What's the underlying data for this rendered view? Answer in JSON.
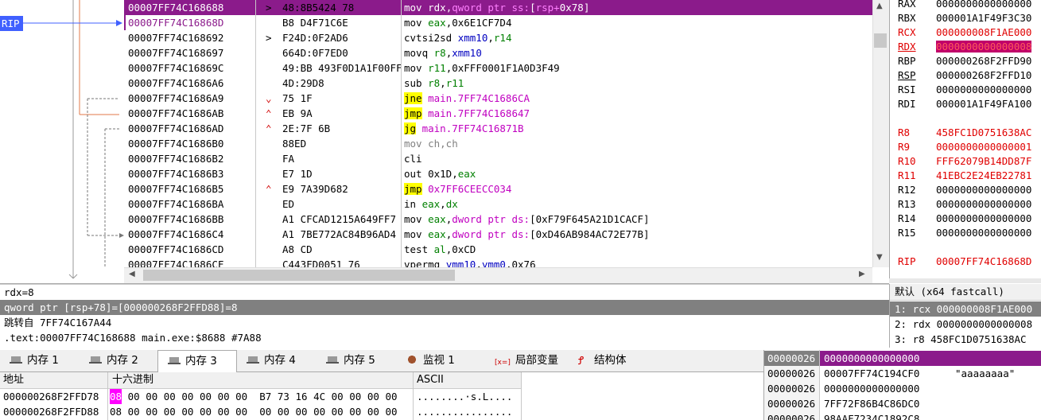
{
  "disasm": {
    "rip_label": "RIP",
    "rows": [
      {
        "addr": "00007FF74C168688",
        "jm": ">",
        "bytes": "48:8B5424 78",
        "insn": [
          [
            "mov ",
            "c"
          ],
          [
            "rdx",
            "r"
          ],
          [
            ",",
            ""
          ],
          [
            "qword ptr ss:",
            "m"
          ],
          [
            "[",
            "c"
          ],
          [
            "rsp+",
            "m"
          ],
          [
            "0x78",
            "c"
          ],
          [
            "]",
            "c"
          ]
        ]
      },
      {
        "addr": "00007FF74C16868D",
        "jm": "",
        "bytes": "B8 D4F71C6E",
        "insn": [
          [
            "mov ",
            ""
          ],
          [
            "eax",
            "g"
          ],
          [
            ",0x6E1CF7D4",
            ""
          ]
        ]
      },
      {
        "addr": "00007FF74C168692",
        "jm": ">",
        "bytes": "F24D:0F2AD6",
        "insn": [
          [
            "cvtsi2sd ",
            ""
          ],
          [
            "xmm10",
            "b"
          ],
          [
            ",",
            ""
          ],
          [
            "r14",
            "g"
          ]
        ]
      },
      {
        "addr": "00007FF74C168697",
        "jm": "",
        "bytes": "664D:0F7ED0",
        "insn": [
          [
            "movq ",
            ""
          ],
          [
            "r8",
            "g"
          ],
          [
            ",",
            ""
          ],
          [
            "xmm10",
            "b"
          ]
        ]
      },
      {
        "addr": "00007FF74C16869C",
        "jm": "",
        "bytes": "49:BB 493F0D1A1F00FF",
        "insn": [
          [
            "mov ",
            ""
          ],
          [
            "r11",
            "g"
          ],
          [
            ",0xFFF0001F1A0D3F49",
            ""
          ]
        ]
      },
      {
        "addr": "00007FF74C1686A6",
        "jm": "",
        "bytes": "4D:29D8",
        "insn": [
          [
            "sub ",
            ""
          ],
          [
            "r8",
            "g"
          ],
          [
            ",",
            ""
          ],
          [
            "r11",
            "g"
          ]
        ]
      },
      {
        "addr": "00007FF74C1686A9",
        "jm": "v",
        "bytes": "75 1F",
        "insn": [
          [
            "jne",
            "j"
          ],
          [
            " main.7FF74C1686CA",
            "l"
          ]
        ]
      },
      {
        "addr": "00007FF74C1686AB",
        "jm": "^",
        "bytes": "EB 9A",
        "insn": [
          [
            "jmp",
            "j"
          ],
          [
            " main.7FF74C168647",
            "l"
          ]
        ]
      },
      {
        "addr": "00007FF74C1686AD",
        "jm": "^",
        "bytes": "2E:7F 6B",
        "insn": [
          [
            "jg",
            "j"
          ],
          [
            " main.7FF74C16871B",
            "l"
          ]
        ]
      },
      {
        "addr": "00007FF74C1686B0",
        "jm": "",
        "bytes": "88ED",
        "insn": [
          [
            "mov ch,ch",
            "y"
          ]
        ]
      },
      {
        "addr": "00007FF74C1686B2",
        "jm": "",
        "bytes": "FA",
        "insn": [
          [
            "cli",
            ""
          ]
        ]
      },
      {
        "addr": "00007FF74C1686B3",
        "jm": "",
        "bytes": "E7 1D",
        "insn": [
          [
            "out 0x1D,",
            ""
          ],
          [
            "eax",
            "g"
          ]
        ]
      },
      {
        "addr": "00007FF74C1686B5",
        "jm": "^",
        "bytes": "E9 7A39D682",
        "insn": [
          [
            "jmp",
            "j"
          ],
          [
            " 0x7FF6CEECC034",
            "l"
          ]
        ]
      },
      {
        "addr": "00007FF74C1686BA",
        "jm": "",
        "bytes": "ED",
        "insn": [
          [
            "in ",
            ""
          ],
          [
            "eax",
            "g"
          ],
          [
            ",",
            ""
          ],
          [
            "dx",
            "g"
          ]
        ]
      },
      {
        "addr": "00007FF74C1686BB",
        "jm": "",
        "bytes": "A1 CFCAD1215A649FF7",
        "insn": [
          [
            "mov ",
            ""
          ],
          [
            "eax",
            "g"
          ],
          [
            ",",
            ""
          ],
          [
            "dword ptr ds:",
            "m"
          ],
          [
            "[0xF79F645A21D1CACF]",
            ""
          ]
        ]
      },
      {
        "addr": "00007FF74C1686C4",
        "jm": "",
        "bytes": "A1 7BE772AC84B96AD4",
        "insn": [
          [
            "mov ",
            ""
          ],
          [
            "eax",
            "g"
          ],
          [
            ",",
            ""
          ],
          [
            "dword ptr ds:",
            "m"
          ],
          [
            "[0xD46AB984AC72E77B]",
            ""
          ]
        ]
      },
      {
        "addr": "00007FF74C1686CD",
        "jm": "",
        "bytes": "A8 CD",
        "insn": [
          [
            "test ",
            ""
          ],
          [
            "al",
            "g"
          ],
          [
            ",0xCD",
            ""
          ]
        ]
      },
      {
        "addr": "00007FF74C1686CF",
        "jm": "",
        "bytes": "C443FD0051 76",
        "insn": [
          [
            "vpermq ",
            ""
          ],
          [
            "ymm10",
            "b"
          ],
          [
            ",",
            ""
          ],
          [
            "ymm0",
            "b"
          ],
          [
            ",0x76",
            ""
          ]
        ]
      }
    ]
  },
  "registers": [
    {
      "name": "RAX",
      "value": "0000000000000000",
      "changed": false
    },
    {
      "name": "RBX",
      "value": "000001A1F49F3C30",
      "changed": false
    },
    {
      "name": "RCX",
      "value": "000000008F1AE000",
      "changed": true
    },
    {
      "name": "RDX",
      "value": "0000000000000008",
      "changed": true,
      "highlight": true
    },
    {
      "name": "RBP",
      "value": "000000268F2FFD90",
      "changed": false
    },
    {
      "name": "RSP",
      "value": "000000268F2FFD10",
      "changed": false
    },
    {
      "name": "RSI",
      "value": "0000000000000000",
      "changed": false
    },
    {
      "name": "RDI",
      "value": "000001A1F49FA100",
      "changed": false
    },
    {
      "name": "",
      "value": "",
      "changed": false
    },
    {
      "name": "R8",
      "value": "458FC1D0751638AC",
      "changed": true
    },
    {
      "name": "R9",
      "value": "0000000000000001",
      "changed": true
    },
    {
      "name": "R10",
      "value": "FFF62079B14DD87F",
      "changed": true
    },
    {
      "name": "R11",
      "value": "41EBC2E24EB22781",
      "changed": true
    },
    {
      "name": "R12",
      "value": "0000000000000000",
      "changed": false
    },
    {
      "name": "R13",
      "value": "0000000000000000",
      "changed": false
    },
    {
      "name": "R14",
      "value": "0000000000000000",
      "changed": false
    },
    {
      "name": "R15",
      "value": "0000000000000000",
      "changed": false
    },
    {
      "name": "",
      "value": "",
      "changed": false
    },
    {
      "name": "RIP",
      "value": "00007FF74C16868D",
      "changed": true
    }
  ],
  "info": {
    "line1": "rdx=8",
    "line2": "qword ptr [rsp+78]=[000000268F2FFD88]=8",
    "line3": "跳转自 7FF74C167A44",
    "line4": ".text:00007FF74C168688 main.exe:$8688 #7A88"
  },
  "callconv": {
    "header": "默认 (x64 fastcall)",
    "args": [
      "1: rcx 000000008F1AE000",
      "2: rdx 0000000000000008",
      "3: r8 458FC1D0751638AC"
    ]
  },
  "tabs": [
    {
      "label": "内存 1",
      "icon": "memory-icon",
      "active": false
    },
    {
      "label": "内存 2",
      "icon": "memory-icon",
      "active": false
    },
    {
      "label": "内存 3",
      "icon": "memory-icon",
      "active": true
    },
    {
      "label": "内存 4",
      "icon": "memory-icon",
      "active": false
    },
    {
      "label": "内存 5",
      "icon": "memory-icon",
      "active": false
    },
    {
      "label": "监视 1",
      "icon": "watch-icon",
      "active": false
    },
    {
      "label": "局部变量",
      "icon": "locals-icon",
      "active": false
    },
    {
      "label": "结构体",
      "icon": "struct-icon",
      "active": false
    }
  ],
  "dump": {
    "headers": {
      "address": "地址",
      "hex": "十六进制",
      "ascii": "ASCII"
    },
    "rows": [
      {
        "addr": "000000268F2FFD78",
        "hex": [
          "08",
          "00",
          "00",
          "00",
          "00",
          "00",
          "00",
          "00",
          "B7",
          "73",
          "16",
          "4C",
          "00",
          "00",
          "00",
          "00"
        ],
        "ascii": "........·s.L...."
      },
      {
        "addr": "000000268F2FFD88",
        "hex": [
          "08",
          "00",
          "00",
          "00",
          "00",
          "00",
          "00",
          "00",
          "00",
          "00",
          "00",
          "00",
          "00",
          "00",
          "00",
          "00"
        ],
        "ascii": "................"
      }
    ]
  },
  "stack": {
    "rows": [
      {
        "addr": "00000026",
        "value": "0000000000000000",
        "comment": "",
        "selected": true
      },
      {
        "addr": "00000026",
        "value": "00007FF74C194CF0",
        "comment": "\"aaaaaaaa\"",
        "selected": false
      },
      {
        "addr": "00000026",
        "value": "0000000000000000",
        "comment": "",
        "selected": false
      },
      {
        "addr": "00000026",
        "value": "7FF72F86B4C86DC0",
        "comment": "",
        "selected": false
      },
      {
        "addr": "00000026",
        "value": "98AAF7234C1892C8",
        "comment": "",
        "selected": false
      }
    ]
  },
  "colors": {
    "accent": "#8b1b8b",
    "jump_highlight": "#ffff00",
    "changed_register": "#e00000"
  }
}
